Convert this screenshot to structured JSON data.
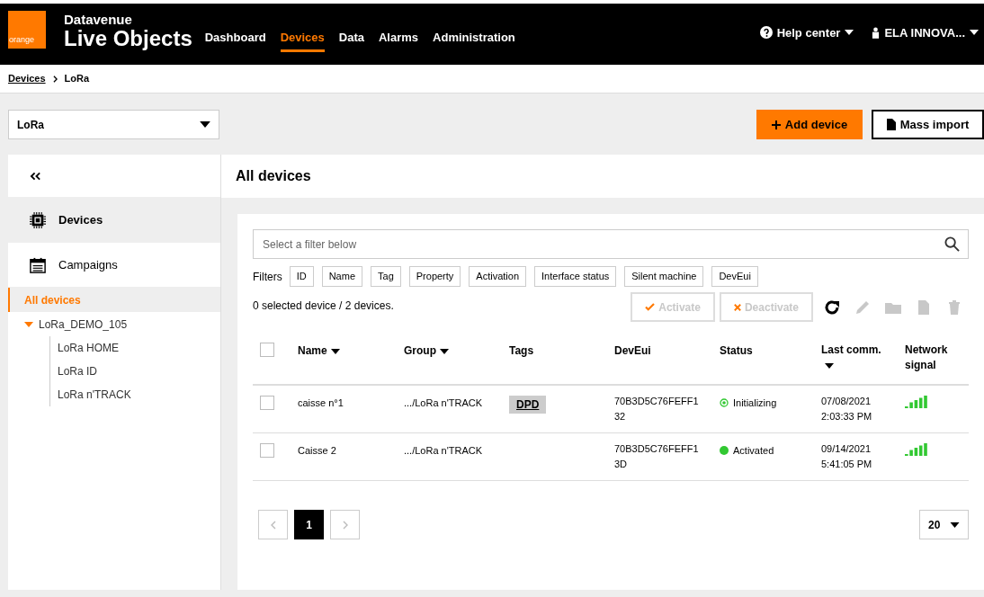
{
  "header": {
    "logo": "orange",
    "product_line": "Datavenue",
    "product": "Live Objects",
    "nav": [
      {
        "label": "Dashboard",
        "selected": false
      },
      {
        "label": "Devices",
        "selected": true
      },
      {
        "label": "Data",
        "selected": false
      },
      {
        "label": "Alarms",
        "selected": false
      },
      {
        "label": "Administration",
        "selected": false
      }
    ],
    "help": "Help center",
    "user": "ELA INNOVA..."
  },
  "breadcrumb": [
    {
      "label": "Devices",
      "link": true
    },
    {
      "label": "LoRa",
      "link": false
    }
  ],
  "network_select": {
    "value": "LoRa"
  },
  "buttons": [
    {
      "label": "Add device",
      "kind": "primary"
    },
    {
      "label": "Mass import",
      "kind": "secondary"
    }
  ],
  "sidebar": {
    "items": [
      {
        "label": "Devices",
        "kind": "chip",
        "selected": true
      },
      {
        "label": "Campaigns",
        "kind": "calendar",
        "selected": false
      }
    ],
    "tree": [
      {
        "label": "All devices",
        "selected": true
      },
      {
        "label": "LoRa_DEMO_105",
        "selected": false,
        "expanded": true,
        "children": [
          {
            "label": "LoRa HOME",
            "selected": false
          },
          {
            "label": "LoRa ID",
            "selected": false
          },
          {
            "label": "LoRa n'TRACK",
            "selected": false
          }
        ]
      }
    ]
  },
  "main": {
    "title": "All devices",
    "search": {
      "placeholder": "Select a filter below"
    },
    "filters_label": "Filters",
    "filters": [
      "ID",
      "Name",
      "Tag",
      "Property",
      "Activation",
      "Interface status",
      "Silent machine",
      "DevEui"
    ],
    "selection_count": "0 selected device / 2 devices.",
    "actions": [
      {
        "label": "Activate",
        "kind": "check",
        "disabled": true
      },
      {
        "label": "Deactivate",
        "kind": "cross",
        "disabled": true
      }
    ],
    "tools": [
      {
        "kind": "refresh",
        "disabled": false
      },
      {
        "kind": "edit",
        "disabled": true
      },
      {
        "kind": "folder",
        "disabled": true
      },
      {
        "kind": "file",
        "disabled": true
      },
      {
        "kind": "trash",
        "disabled": true
      }
    ],
    "table": {
      "select_all": {
        "checked": false
      },
      "columns": [
        {
          "label": "Name",
          "sortable": true
        },
        {
          "label": "Group",
          "sortable": true
        },
        {
          "label": "Tags",
          "sortable": false
        },
        {
          "label": "DevEui",
          "sortable": false
        },
        {
          "label": "Status",
          "sortable": false
        },
        {
          "label": "Last comm.",
          "sortable": true
        },
        {
          "label": "Network signal",
          "sortable": false
        }
      ],
      "rows": [
        {
          "checked": false,
          "name": "caisse n°1",
          "group": ".../LoRa n'TRACK",
          "tags": [
            "DPD"
          ],
          "deveui": [
            "70B3D5C76FEFF1",
            "32"
          ],
          "status": {
            "kind": "initializing",
            "label": "Initializing"
          },
          "last_comm": [
            "07/08/2021",
            "2:03:33 PM"
          ]
        },
        {
          "checked": false,
          "name": "Caisse 2",
          "group": ".../LoRa n'TRACK",
          "tags": [],
          "deveui": [
            "70B3D5C76FEFF1",
            "3D"
          ],
          "status": {
            "kind": "activated",
            "label": "Activated"
          },
          "last_comm": [
            "09/14/2021",
            "5:41:05 PM"
          ]
        }
      ]
    },
    "pagination": {
      "pages": [
        {
          "label": "1",
          "selected": true
        }
      ],
      "page_size": "20"
    }
  }
}
